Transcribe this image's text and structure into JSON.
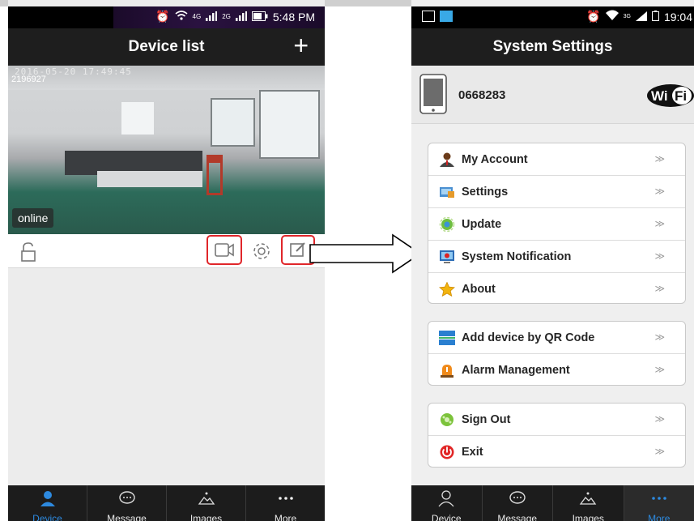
{
  "left": {
    "status": {
      "time": "5:48 PM",
      "net1": "4G",
      "net2": "2G"
    },
    "header": {
      "title": "Device list",
      "add_label": "+"
    },
    "camera": {
      "timestamp": "2016-05-20 17:49:45",
      "device_id": "2196927",
      "status_label": "online"
    },
    "tabs": [
      {
        "label": "Device",
        "icon": "person-icon",
        "active": true
      },
      {
        "label": "Message",
        "icon": "chat-bubble-icon",
        "active": false
      },
      {
        "label": "Images",
        "icon": "image-icon",
        "active": false
      },
      {
        "label": "More",
        "icon": "more-dots-icon",
        "active": false
      }
    ]
  },
  "right": {
    "status": {
      "time": "19:04",
      "net": "3G"
    },
    "header": {
      "title": "System Settings"
    },
    "device": {
      "name": "0668283",
      "badge": "WiFi"
    },
    "groups": [
      [
        {
          "label": "My Account",
          "icon": "account-icon"
        },
        {
          "label": "Settings",
          "icon": "settings-icon"
        },
        {
          "label": "Update",
          "icon": "update-icon"
        },
        {
          "label": "System Notification",
          "icon": "notification-icon"
        },
        {
          "label": "About",
          "icon": "star-icon"
        }
      ],
      [
        {
          "label": "Add device by QR Code",
          "icon": "qr-scan-icon"
        },
        {
          "label": "Alarm Management",
          "icon": "alarm-icon"
        }
      ],
      [
        {
          "label": "Sign Out",
          "icon": "sign-out-icon"
        },
        {
          "label": "Exit",
          "icon": "power-icon"
        }
      ]
    ],
    "chevron": "≫",
    "tabs": [
      {
        "label": "Device",
        "icon": "person-icon",
        "active": false
      },
      {
        "label": "Message",
        "icon": "chat-bubble-icon",
        "active": false
      },
      {
        "label": "Images",
        "icon": "image-icon",
        "active": false
      },
      {
        "label": "More",
        "icon": "more-dots-icon",
        "active": true
      }
    ]
  },
  "colors": {
    "accent": "#2d8ae0",
    "highlight": "#e0262a",
    "bar": "#1e1e1e"
  }
}
